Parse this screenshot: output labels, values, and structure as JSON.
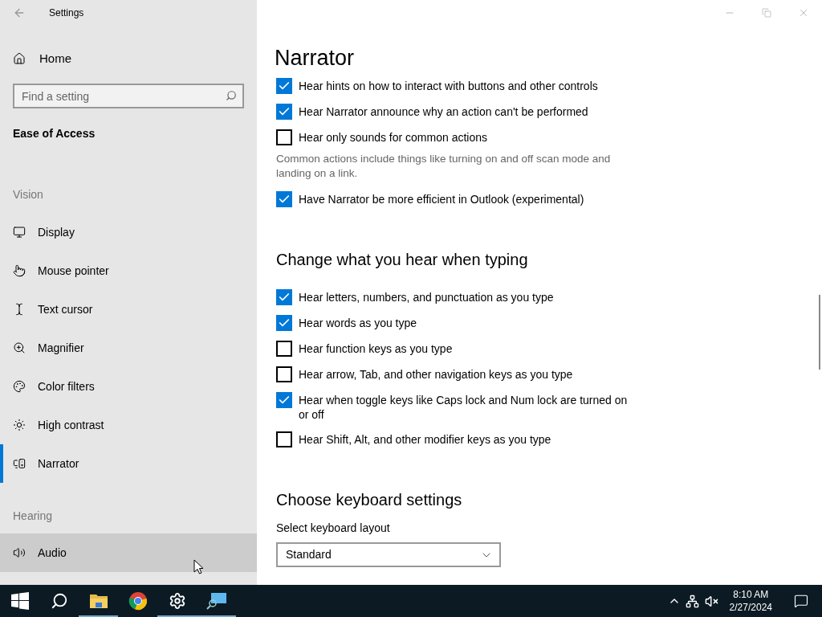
{
  "window": {
    "title": "Settings"
  },
  "sidebar": {
    "home": "Home",
    "search": {
      "placeholder": "Find a setting"
    },
    "category": "Ease of Access",
    "groups": [
      {
        "heading": "Vision",
        "items": [
          {
            "label": "Display",
            "selected": false,
            "hovered": false
          },
          {
            "label": "Mouse pointer",
            "selected": false,
            "hovered": false
          },
          {
            "label": "Text cursor",
            "selected": false,
            "hovered": false
          },
          {
            "label": "Magnifier",
            "selected": false,
            "hovered": false
          },
          {
            "label": "Color filters",
            "selected": false,
            "hovered": false
          },
          {
            "label": "High contrast",
            "selected": false,
            "hovered": false
          },
          {
            "label": "Narrator",
            "selected": true,
            "hovered": false
          }
        ]
      },
      {
        "heading": "Hearing",
        "items": [
          {
            "label": "Audio",
            "selected": false,
            "hovered": true
          }
        ]
      }
    ]
  },
  "page": {
    "title": "Narrator",
    "sections": [
      {
        "items": [
          {
            "kind": "checkbox",
            "label": "Hear hints on how to interact with buttons and other controls",
            "checked": true
          },
          {
            "kind": "checkbox",
            "label": "Hear Narrator announce why an action can't be performed",
            "checked": true
          },
          {
            "kind": "checkbox",
            "label": "Hear only sounds for common actions",
            "checked": false
          },
          {
            "kind": "note",
            "text": "Common actions include things like turning on and off scan mode and landing on a link."
          },
          {
            "kind": "checkbox",
            "label": "Have Narrator be more efficient in Outlook (experimental)",
            "checked": true
          }
        ]
      },
      {
        "heading": "Change what you hear when typing",
        "items": [
          {
            "kind": "checkbox",
            "label": "Hear letters, numbers, and punctuation as you type",
            "checked": true
          },
          {
            "kind": "checkbox",
            "label": "Hear words as you type",
            "checked": true
          },
          {
            "kind": "checkbox",
            "label": "Hear function keys as you type",
            "checked": false
          },
          {
            "kind": "checkbox",
            "label": "Hear arrow, Tab, and other navigation keys as you type",
            "checked": false
          },
          {
            "kind": "checkbox",
            "label": "Hear when toggle keys like Caps lock and Num lock are turned on or off",
            "checked": true
          },
          {
            "kind": "checkbox",
            "label": "Hear Shift, Alt, and other modifier keys as you type",
            "checked": false
          }
        ]
      },
      {
        "heading": "Choose keyboard settings",
        "items": [
          {
            "kind": "select",
            "label": "Select keyboard layout",
            "value": "Standard"
          }
        ]
      }
    ]
  },
  "taskbar": {
    "apps": [
      {
        "running": true
      },
      {
        "running": false
      },
      {
        "running": true
      },
      {
        "running": true
      }
    ],
    "time": "8:10 AM",
    "date": "2/27/2024"
  }
}
